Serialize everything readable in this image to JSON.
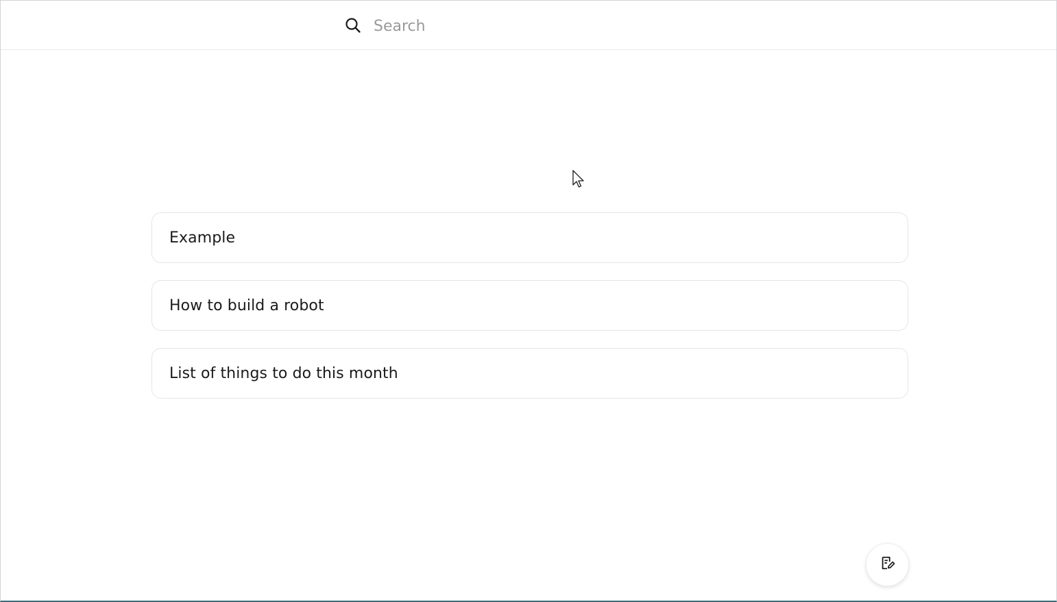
{
  "search": {
    "placeholder": "Search",
    "value": ""
  },
  "notes": [
    {
      "title": "Example"
    },
    {
      "title": "How to build a robot"
    },
    {
      "title": "List of things to do this month"
    }
  ],
  "actions": {
    "new_note_icon": "new-note-icon"
  },
  "colors": {
    "border": "#e3e5e8",
    "text": "#1a1a1a",
    "placeholder": "#9a9a9a",
    "window_bottom": "#3a6a7a"
  }
}
